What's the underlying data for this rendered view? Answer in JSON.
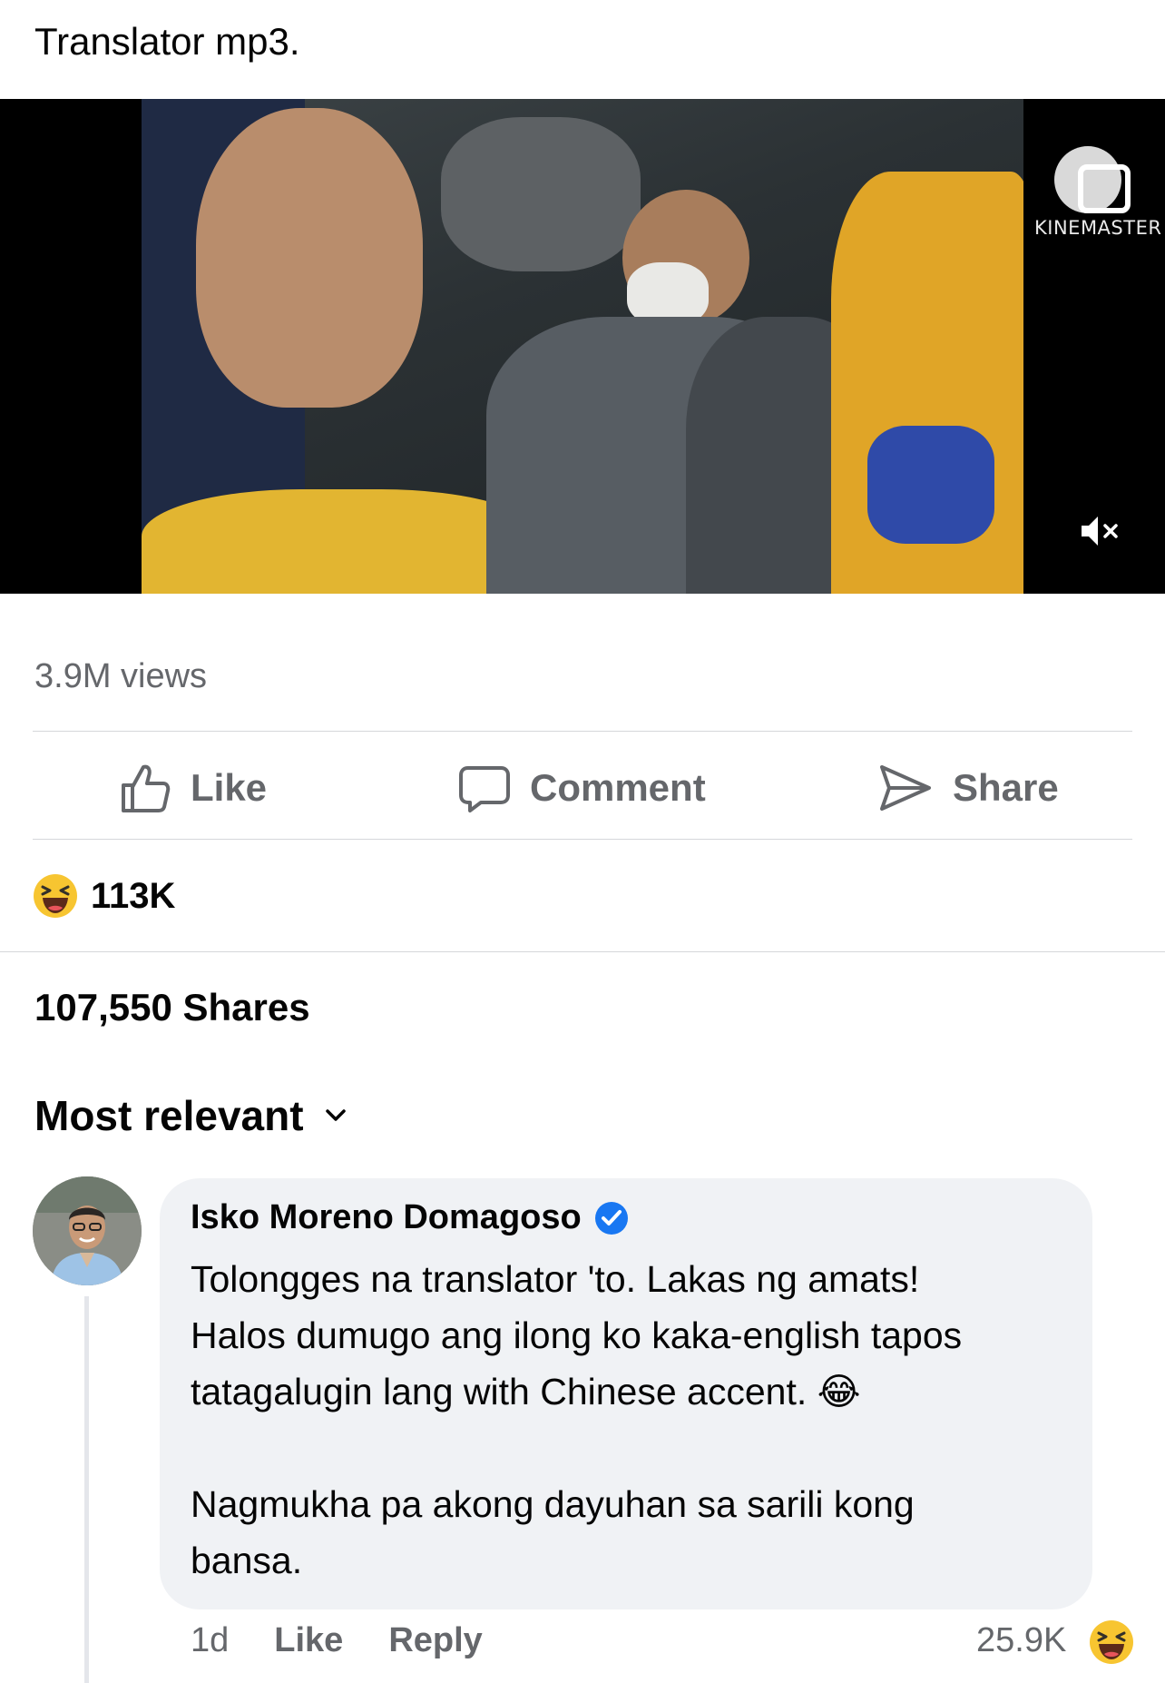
{
  "post": {
    "text": "Translator mp3."
  },
  "video": {
    "watermark_text": "KINEMASTER",
    "watermark_icon": "kinemaster-logo-icon",
    "mute_icon": "speaker-muted-icon"
  },
  "stats": {
    "views": "3.9M views"
  },
  "actions": [
    {
      "label": "Like",
      "icon": "thumbs-up-icon"
    },
    {
      "label": "Comment",
      "icon": "speech-bubble-icon"
    },
    {
      "label": "Share",
      "icon": "share-arrow-icon"
    }
  ],
  "reactions": {
    "emoji": "laughing-face-icon",
    "count": "113K"
  },
  "shares": "107,550 Shares",
  "sort": {
    "label": "Most relevant",
    "icon": "chevron-down-icon"
  },
  "comment": {
    "author": "Isko Moreno Domagoso",
    "verified_icon": "verified-badge-icon",
    "lines": [
      "Tolongges na translator 'to. Lakas ng amats!",
      "Halos dumugo ang ilong ko kaka-english tapos",
      "tatagalugin lang with Chinese accent. 😂",
      "Nagmukha pa akong dayuhan sa sarili kong",
      "bansa."
    ],
    "time": "1d",
    "like_label": "Like",
    "reply_label": "Reply",
    "reaction_count": "25.9K",
    "reaction_emoji": "laughing-face-icon"
  },
  "colors": {
    "text_primary": "#050505",
    "text_secondary": "#65676b",
    "bubble_bg": "#f0f2f5",
    "verified_blue": "#1877f2",
    "emoji_yellow": "#f7c531"
  }
}
